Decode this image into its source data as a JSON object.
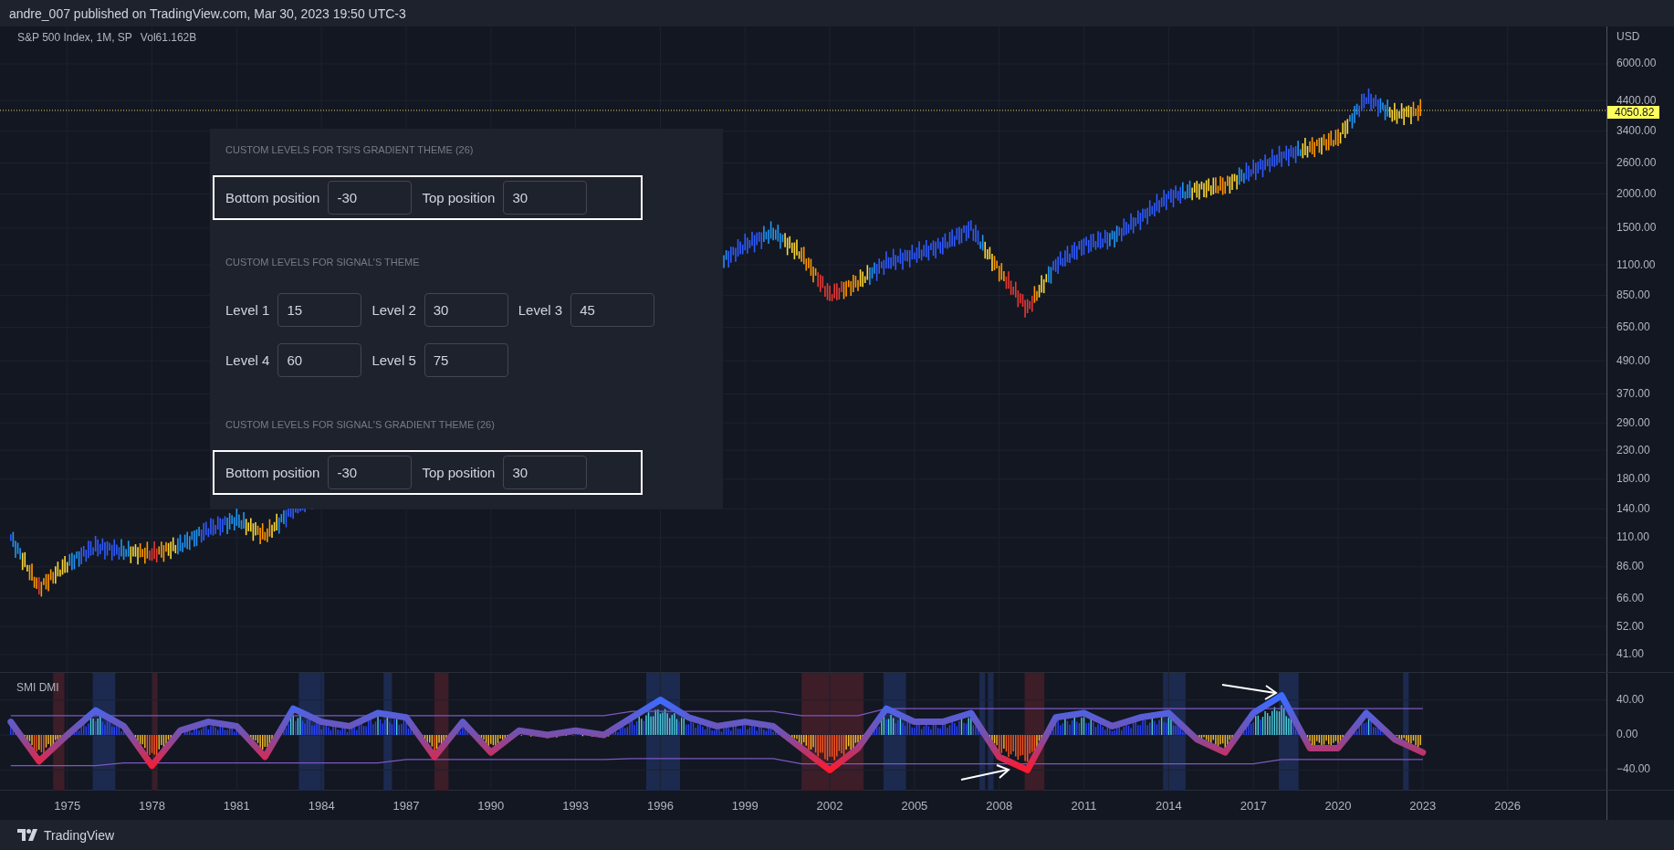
{
  "header": {
    "text": "andre_007 published on TradingView.com, Mar 30, 2023 19:50 UTC-3"
  },
  "main_pane": {
    "symbol": "S&P 500 Index, 1M, SP",
    "volume": "Vol61.162B",
    "currency": "USD",
    "last_price": "4050.82",
    "price_scale": [
      "6000.00",
      "4400.00",
      "3400.00",
      "2600.00",
      "2000.00",
      "1500.00",
      "1100.00",
      "850.00",
      "650.00",
      "490.00",
      "370.00",
      "290.00",
      "230.00",
      "180.00",
      "140.00",
      "110.00",
      "86.00",
      "66.00",
      "52.00",
      "41.00"
    ]
  },
  "settings_panel": {
    "sections": [
      {
        "title": "CUSTOM LEVELS FOR TSI'S GRADIENT THEME (26)",
        "highlighted": true,
        "rows": [
          [
            {
              "label": "Bottom position",
              "value": "-30"
            },
            {
              "label": "Top position",
              "value": "30"
            }
          ]
        ]
      },
      {
        "title": "CUSTOM LEVELS FOR SIGNAL'S THEME",
        "highlighted": false,
        "rows": [
          [
            {
              "label": "Level 1",
              "value": "15"
            },
            {
              "label": "Level 2",
              "value": "30"
            },
            {
              "label": "Level 3",
              "value": "45"
            }
          ],
          [
            {
              "label": "Level 4",
              "value": "60"
            },
            {
              "label": "Level 5",
              "value": "75"
            }
          ]
        ]
      },
      {
        "title": "CUSTOM LEVELS FOR SIGNAL'S GRADIENT THEME (26)",
        "highlighted": true,
        "rows": [
          [
            {
              "label": "Bottom position",
              "value": "-30"
            },
            {
              "label": "Top position",
              "value": "30"
            }
          ]
        ]
      }
    ]
  },
  "indicator_pane": {
    "title": "SMI DMI",
    "scale": [
      "40.00",
      "0.00",
      "−40.00"
    ]
  },
  "time_axis": [
    "1975",
    "1978",
    "1981",
    "1984",
    "1987",
    "1990",
    "1993",
    "1996",
    "1999",
    "2002",
    "2005",
    "2008",
    "2011",
    "2014",
    "2017",
    "2020",
    "2023",
    "2026"
  ],
  "footer": {
    "brand": "TradingView"
  }
}
